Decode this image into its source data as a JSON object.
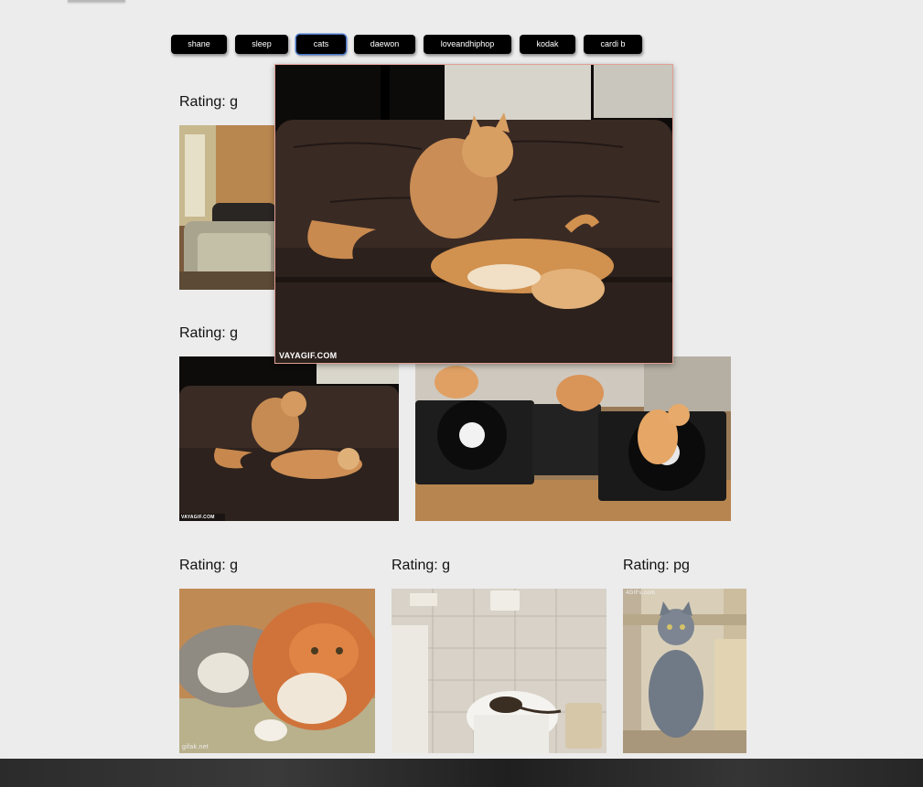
{
  "topics": {
    "buttons": [
      {
        "label": "shane",
        "active": false
      },
      {
        "label": "sleep",
        "active": false
      },
      {
        "label": "cats",
        "active": true
      },
      {
        "label": "daewon",
        "active": false
      },
      {
        "label": "loveandhiphop",
        "active": false
      },
      {
        "label": "kodak",
        "active": false
      },
      {
        "label": "cardi b",
        "active": false
      }
    ]
  },
  "gifs": [
    {
      "rating": "Rating: g",
      "subject": "cat-on-couch-living-room"
    },
    {
      "rating": "Rating: g",
      "subject": "cats-on-leather-sofa"
    },
    {
      "rating": "",
      "subject": "kittens-on-turntables"
    },
    {
      "rating": "Rating: g",
      "subject": "orange-and-gray-cats-sleeping",
      "watermark": "gifak.net"
    },
    {
      "rating": "Rating: g",
      "subject": "kitten-on-toilet"
    },
    {
      "rating": "Rating: pg",
      "subject": "gray-cat-in-wooden-crate",
      "watermark": "4GIFs.com"
    }
  ],
  "popup": {
    "subject": "cats-on-leather-sofa-enlarged",
    "watermark": "VAYAGIF.COM"
  },
  "thumb_watermark": "VAYAGIF.COM",
  "colors": {
    "page_bg": "#ececec",
    "button_bg": "#000000",
    "button_text": "#ffffff",
    "active_outline": "#4a78c8",
    "popup_border": "#e1a095"
  }
}
